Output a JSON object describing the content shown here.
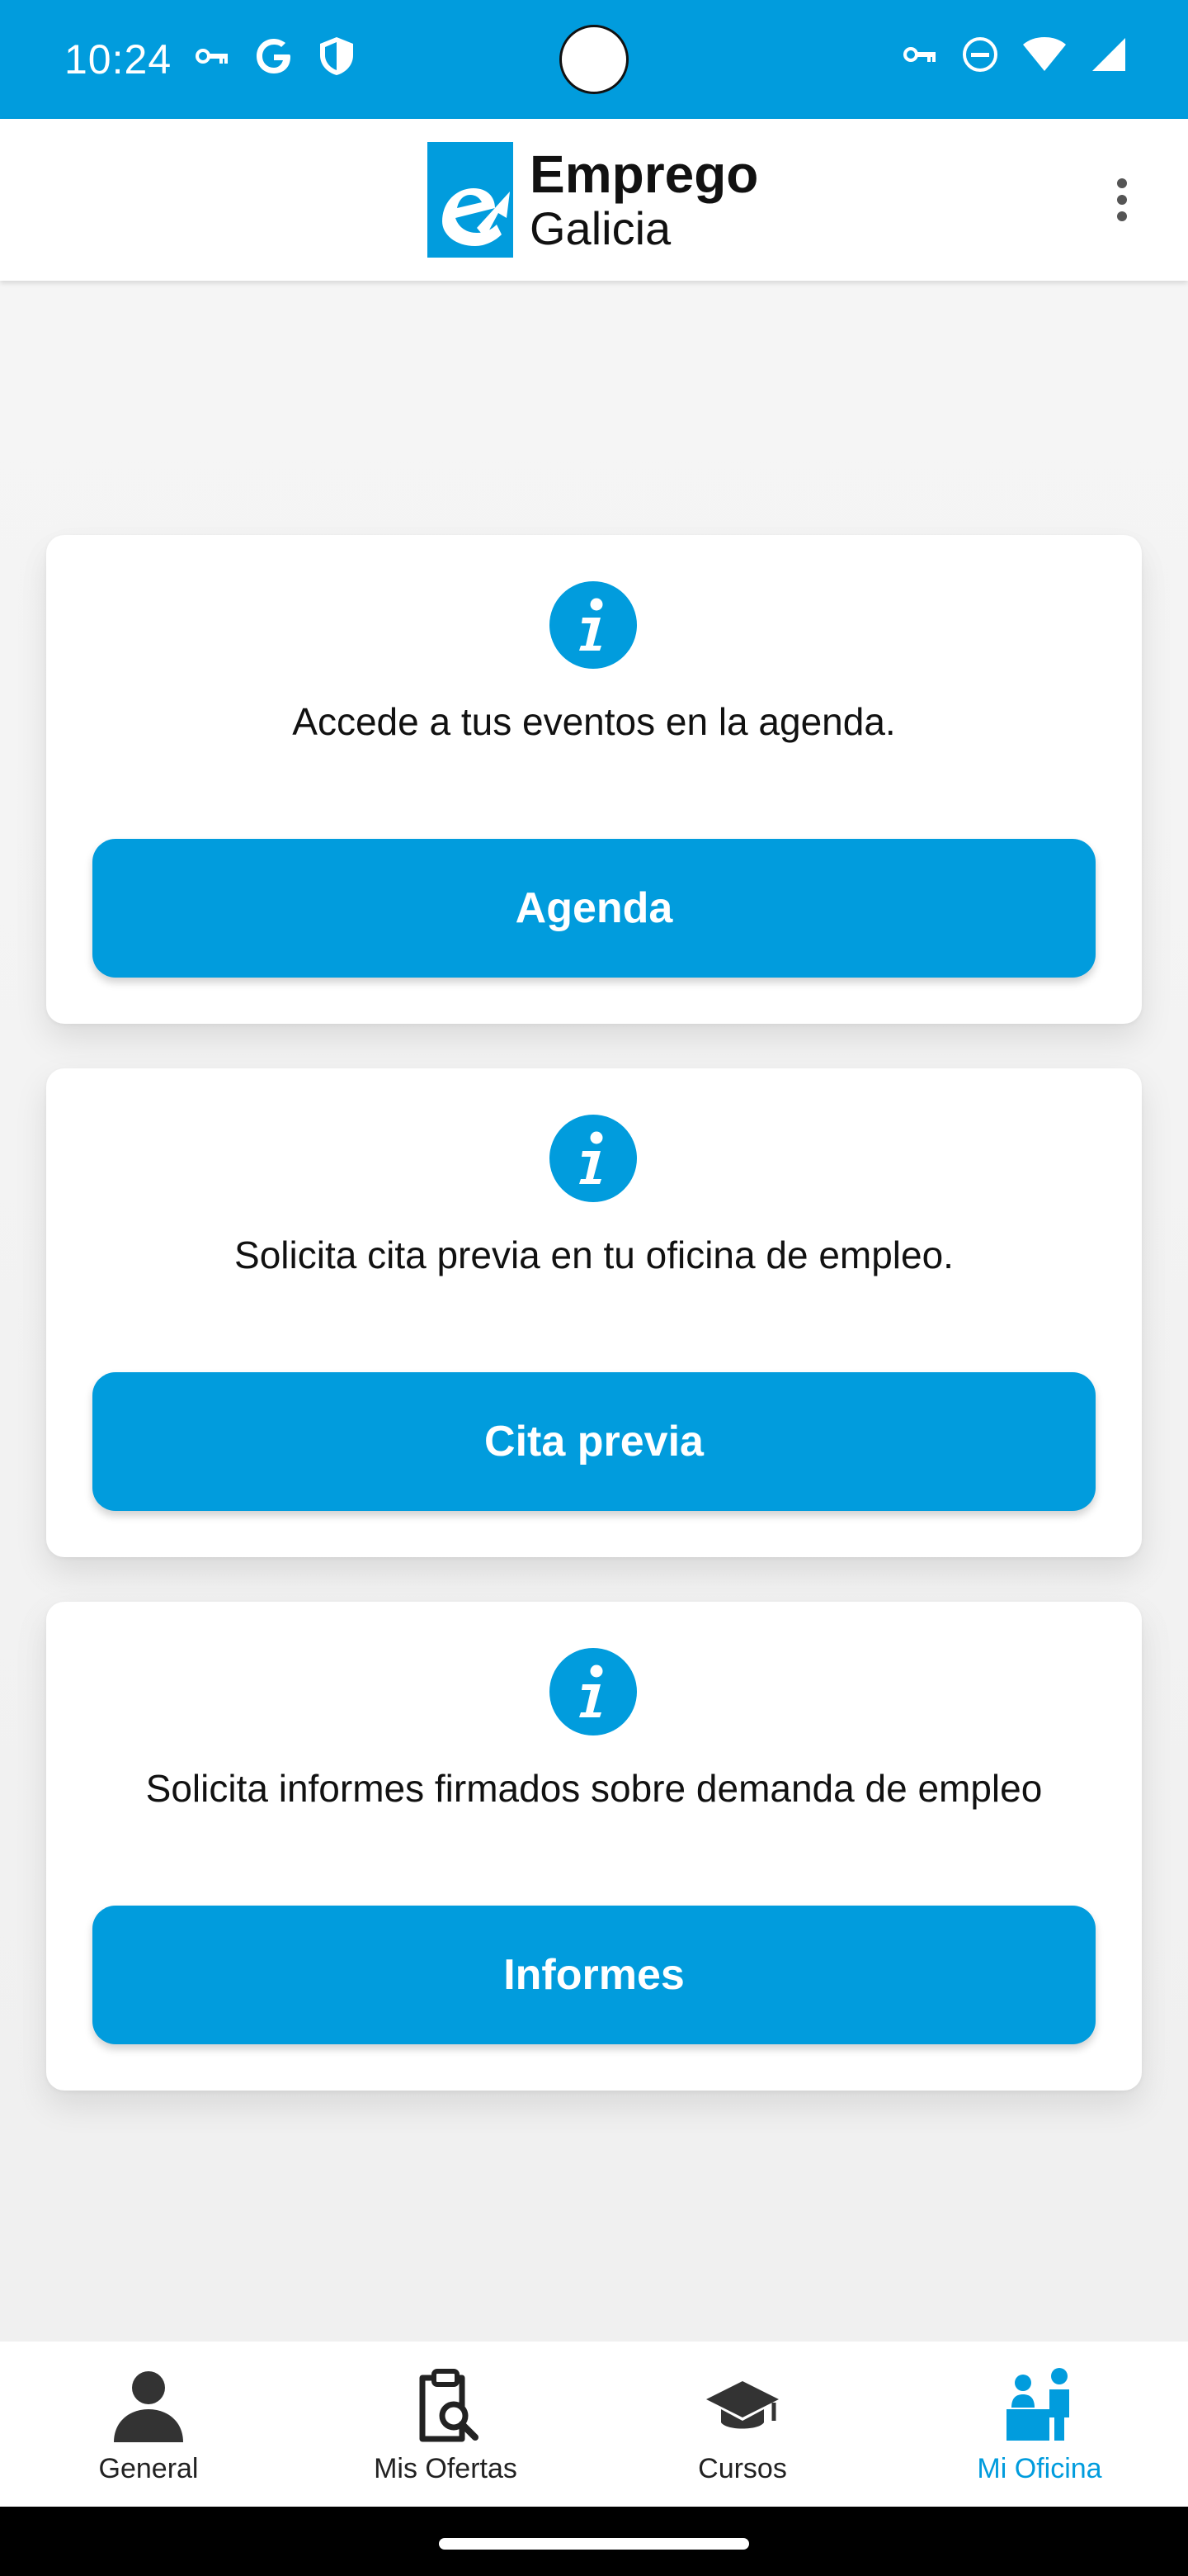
{
  "status_bar": {
    "time": "10:24",
    "left_icons": [
      "vpn-key-icon",
      "google-icon",
      "shield-icon"
    ],
    "right_icons": [
      "vpn-key-icon",
      "do-not-disturb-icon",
      "wifi-icon",
      "signal-icon"
    ]
  },
  "app_bar": {
    "logo_brand": "Emprego",
    "logo_sub": "Galicia",
    "menu_icon": "more-vert-icon"
  },
  "cards": [
    {
      "icon": "info-icon",
      "text": "Accede a tus eventos en la agenda.",
      "button_label": "Agenda"
    },
    {
      "icon": "info-icon",
      "text": "Solicita cita previa en tu oficina de empleo.",
      "button_label": "Cita previa"
    },
    {
      "icon": "info-icon",
      "text": "Solicita informes firmados sobre demanda de empleo",
      "button_label": "Informes"
    }
  ],
  "bottom_nav": {
    "active_index": 3,
    "items": [
      {
        "label": "General",
        "icon": "person-icon"
      },
      {
        "label": "Mis Ofertas",
        "icon": "clipboard-search-icon"
      },
      {
        "label": "Cursos",
        "icon": "graduation-cap-icon"
      },
      {
        "label": "Mi Oficina",
        "icon": "office-people-icon"
      }
    ]
  },
  "colors": {
    "accent": "#019cdd",
    "background": "#f4f4f4",
    "card": "#ffffff",
    "text": "#111111",
    "nav_inactive": "#222222"
  }
}
